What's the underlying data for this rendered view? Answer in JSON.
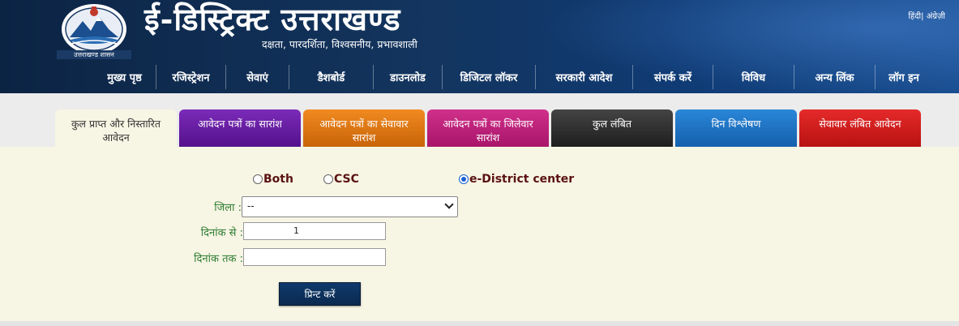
{
  "header": {
    "title": "ई-डिस्ट्रिक्ट उत्तराखण्ड",
    "tagline": "दक्षता, पारदर्शिता, विश्वसनीय, प्रभावशाली",
    "logo_text": "उत्तराखण्ड शासन",
    "lang_hindi": "हिंदी",
    "lang_sep": "|",
    "lang_english": "अंग्रेज़ी"
  },
  "nav": [
    {
      "label": "मुख्य पृष्ठ"
    },
    {
      "label": "रजिस्ट्रेशन"
    },
    {
      "label": "सेवाएं"
    },
    {
      "label": "डैशबोर्ड"
    },
    {
      "label": "डाउनलोड"
    },
    {
      "label": "डिजिटल लॉकर"
    },
    {
      "label": "सरकारी आदेश"
    },
    {
      "label": "संपर्क करें"
    },
    {
      "label": "विविध"
    },
    {
      "label": "अन्य लिंक"
    },
    {
      "label": "लॉग इन"
    }
  ],
  "tabs": [
    {
      "line1": "कुल प्राप्त और निस्तारित",
      "line2": "आवेदन",
      "color": "#f7f5e4"
    },
    {
      "line1": "आवेदन पत्रों का सारांश",
      "line2": "",
      "color": "#6a1aa8"
    },
    {
      "line1": "आवेदन पत्रों का सेवावार",
      "line2": "सारांश",
      "color": "#e07a10"
    },
    {
      "line1": "आवेदन पत्रों का जिलेवार",
      "line2": "सारांश",
      "color": "#c2227a"
    },
    {
      "line1": "कुल लंबित",
      "line2": "",
      "color": "#2e2e2e"
    },
    {
      "line1": "दिन विश्लेषण",
      "line2": "",
      "color": "#1e72c4"
    },
    {
      "line1": "सेवावार लंबित आवेदन",
      "line2": "",
      "color": "#d41e1e"
    }
  ],
  "filters": {
    "radio_both": "Both",
    "radio_csc": "CSC",
    "radio_center": "e-District center",
    "selected": "e-District center",
    "district_label": "जिला :",
    "district_value": "--",
    "from_label": "दिनांक से :",
    "from_value": "1",
    "to_label": "दिनांक तक :",
    "to_value": "",
    "print_label": "प्रिन्ट करें"
  }
}
